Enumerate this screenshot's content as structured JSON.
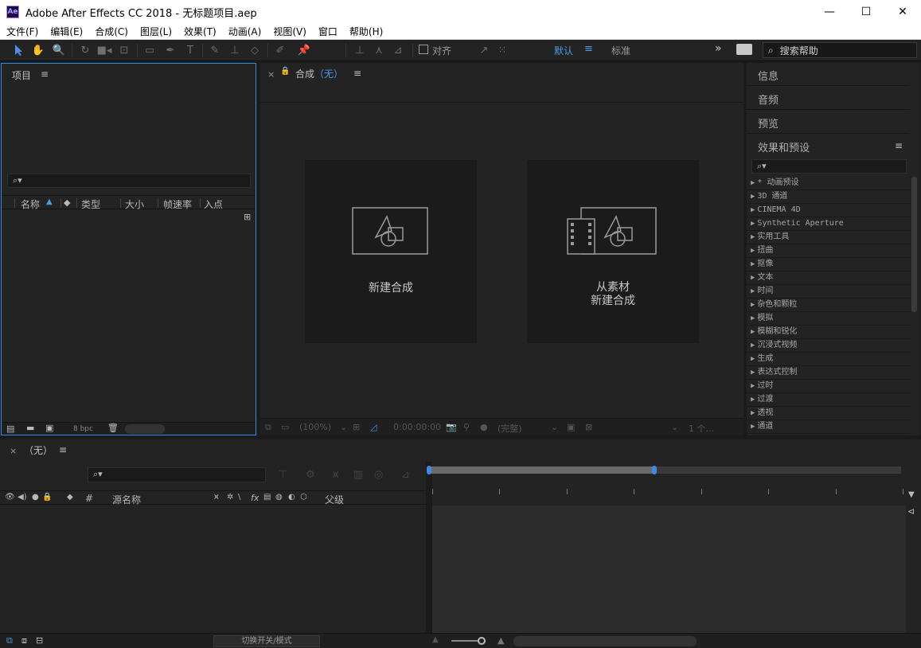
{
  "window": {
    "app_icon": "Ae",
    "title": "Adobe After Effects CC 2018 - 无标题项目.aep",
    "minimize": "—",
    "maximize": "☐",
    "close": "✕"
  },
  "menu": [
    "文件(F)",
    "编辑(E)",
    "合成(C)",
    "图层(L)",
    "效果(T)",
    "动画(A)",
    "视图(V)",
    "窗口",
    "帮助(H)"
  ],
  "toolbar": {
    "align_label": "对齐",
    "workspace_default": "默认",
    "workspace_default_menu": "≡",
    "workspace_standard": "标准",
    "more": "»",
    "help_search_placeholder": "搜索帮助"
  },
  "project": {
    "title": "项目",
    "menu": "≡",
    "search_icon": "⌕▾",
    "columns": {
      "name": "名称",
      "type": "类型",
      "size": "大小",
      "fps": "帧速率",
      "in_point": "入点"
    },
    "bpc": "8 bpc"
  },
  "composition": {
    "close": "×",
    "lock": "🔒",
    "title_prefix": "合成",
    "title_value": "（无）",
    "menu": "≡",
    "new_comp": "新建合成",
    "from_footage_line1": "从素材",
    "from_footage_line2": "新建合成",
    "footer": {
      "zoom": "(100%)",
      "timecode": "0:00:00:00",
      "quality": "(完整)",
      "views": "1 个..."
    }
  },
  "right": {
    "info": "信息",
    "audio": "音频",
    "preview": "预览",
    "effects_presets": "效果和预设",
    "effects_menu": "≡",
    "effects": [
      "* 动画预设",
      "3D 通道",
      "CINEMA 4D",
      "Synthetic Aperture",
      "实用工具",
      "扭曲",
      "抠像",
      "文本",
      "时间",
      "杂色和颗粒",
      "模拟",
      "模糊和锐化",
      "沉浸式视频",
      "生成",
      "表达式控制",
      "过时",
      "过渡",
      "透视",
      "通道"
    ]
  },
  "timeline": {
    "close": "×",
    "title": "（无）",
    "menu": "≡",
    "columns": {
      "hash": "#",
      "source_name": "源名称",
      "fx": "fx",
      "parent": "父级"
    },
    "switch_mode": "切换开关/模式"
  },
  "colors": {
    "accent": "#2d8ceb",
    "workspace_active": "#4a9ae8",
    "panel_bg": "#232323"
  }
}
